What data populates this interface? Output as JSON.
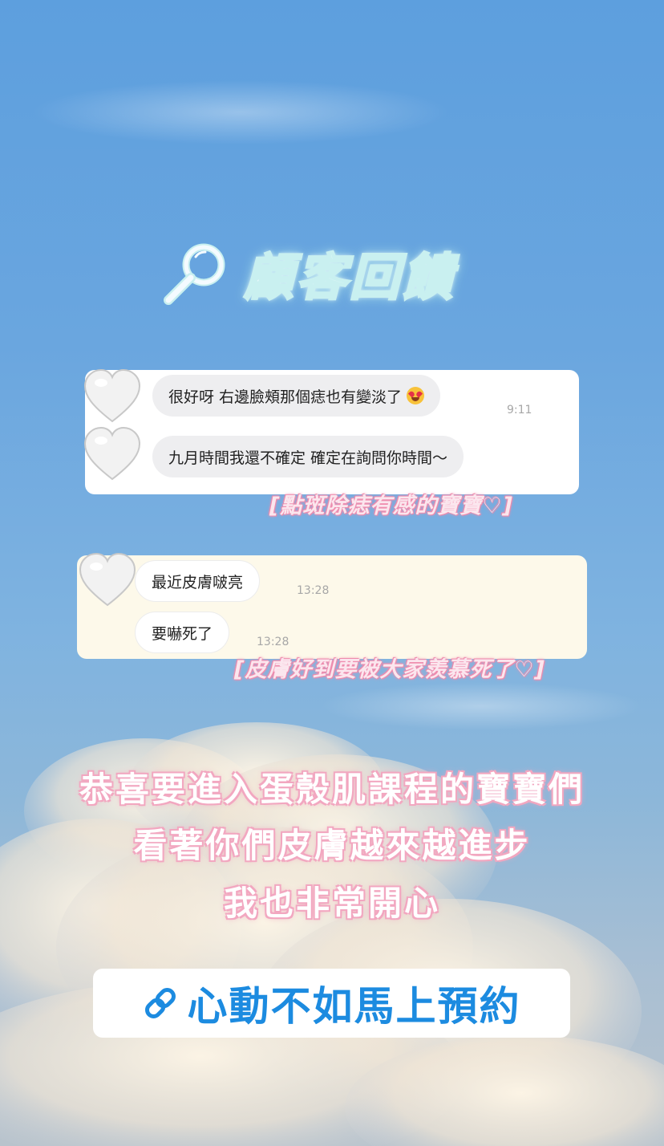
{
  "title": {
    "icon": "magnifier-icon",
    "text": "顧客回饋"
  },
  "chat1": {
    "avatar_icon": "white-heart-icon",
    "messages": [
      {
        "text": "很好呀 右邊臉頰那個痣也有變淡了",
        "emoji": "heart-eyes-emoji",
        "time": "9:11"
      },
      {
        "text": "九月時間我還不確定 確定在詢問你時間～",
        "time": ""
      }
    ],
    "caption": "[點斑除痣有感的寶寶♡]"
  },
  "chat2": {
    "avatar_icon": "white-heart-icon",
    "messages": [
      {
        "text": "最近皮膚啵亮",
        "time": "13:28"
      },
      {
        "text": "要嚇死了",
        "time": "13:28"
      }
    ],
    "caption": "[皮膚好到要被大家羨慕死了♡]"
  },
  "congrats": {
    "line1": "恭喜要進入蛋殼肌課程的寶寶們",
    "line2": "看著你們皮膚越來越進步",
    "line3": "我也非常開心"
  },
  "cta": {
    "icon": "link-icon",
    "label": "心動不如馬上預約"
  },
  "colors": {
    "sky_top": "#5d9fde",
    "cta_text": "#1c8be0",
    "caption_glow": "#f08fb0",
    "card2_bg": "#fdf9ea"
  }
}
